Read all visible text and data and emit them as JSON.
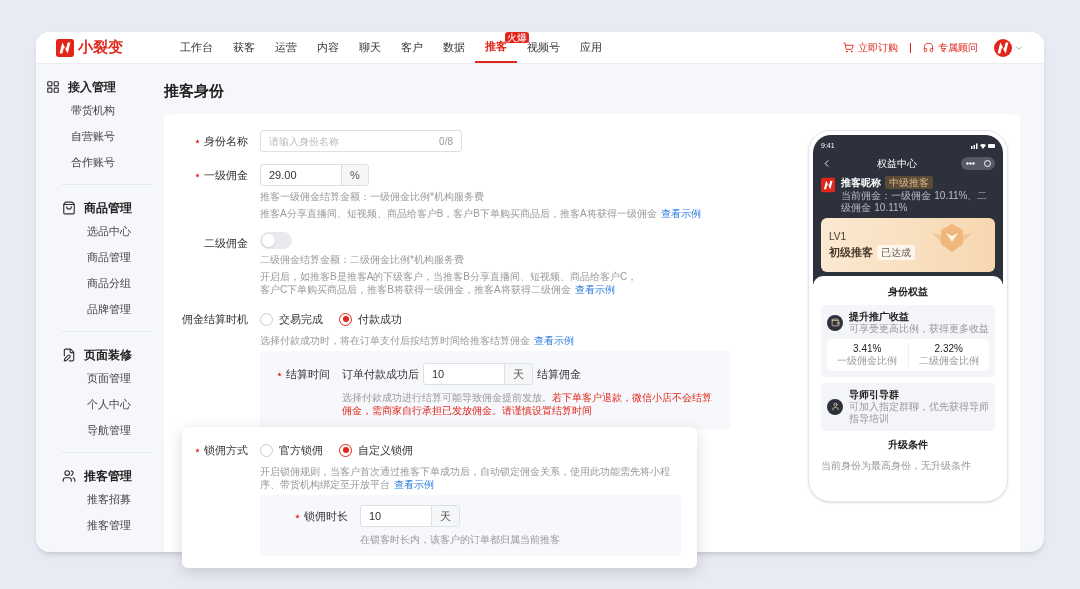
{
  "brand": {
    "name": "小裂变"
  },
  "nav": [
    {
      "label": "工作台",
      "selected": false
    },
    {
      "label": "获客",
      "selected": false
    },
    {
      "label": "运营",
      "selected": false
    },
    {
      "label": "内容",
      "selected": false
    },
    {
      "label": "聊天",
      "selected": false
    },
    {
      "label": "客户",
      "selected": false
    },
    {
      "label": "数据",
      "selected": false
    },
    {
      "label": "推客",
      "selected": true,
      "badge": "火爆"
    },
    {
      "label": "视频号",
      "selected": false
    },
    {
      "label": "应用",
      "selected": false
    }
  ],
  "header_actions": [
    {
      "label": "立即订购"
    },
    {
      "label": "专属顾问"
    }
  ],
  "sidebar": [
    {
      "title": "接入管理",
      "items": [
        "带货机构",
        "自营账号",
        "合作账号"
      ]
    },
    {
      "title": "商品管理",
      "items": [
        "选品中心",
        "商品管理",
        "商品分组",
        "品牌管理"
      ]
    },
    {
      "title": "页面装修",
      "items": [
        "页面管理",
        "个人中心",
        "导航管理"
      ]
    },
    {
      "title": "推客管理",
      "items": [
        "推客招募",
        "推客管理"
      ]
    }
  ],
  "page_title": "推客身份",
  "form": {
    "name_field": {
      "label": "身份名称",
      "required": true,
      "placeholder": "请输入身份名称",
      "counter": "0/8"
    },
    "level1": {
      "label": "一级佣金",
      "required": true,
      "value": "29.00",
      "unit": "%",
      "help": [
        "推客一级佣金结算金额：一级佣金比例*机构服务费",
        "推客A分享直播间、短视频、商品给客户B，客户B下单购买商品后，推客A将获得一级佣金"
      ],
      "link": "查看示例"
    },
    "level2": {
      "label": "二级佣金",
      "required": false,
      "on": false,
      "help": [
        "二级佣金结算金额：二级佣金比例*机构服务费",
        "开启后，如推客B是推客A的下级客户，当推客B分享直播间、短视频、商品给客户C，客户C下单购买商品后，推客B将获得一级佣金，推客A将获得二级佣金"
      ],
      "link": "查看示例"
    },
    "timing": {
      "label": "佣金结算时机",
      "required": false,
      "options": [
        {
          "label": "交易完成",
          "selected": false
        },
        {
          "label": "付款成功",
          "selected": true
        }
      ],
      "help": "选择付款成功时，将在订单支付后按结算时间给推客结算佣金",
      "link": "查看示例",
      "sub": {
        "label": "结算时间",
        "required": true,
        "prefix": "订单付款成功后",
        "value": "10",
        "unit": "天",
        "suffix": "结算佣金",
        "help": "选择付款成功进行结算可能导致佣金提前发放。",
        "warning": "若下单客户退款，微信小店不会结算佣金，需商家自行承担已发放佣金。请谨慎设置结算时间"
      }
    }
  },
  "lock_popup": {
    "label": "锁佣方式",
    "required": true,
    "options": [
      {
        "label": "官方锁佣",
        "selected": false
      },
      {
        "label": "自定义锁佣",
        "selected": true
      }
    ],
    "help": "开启锁佣规则，当客户首次通过推客下单成功后，自动锁定佣金关系，使用此功能需先将小程序、带货机构绑定至开放平台",
    "link": "查看示例",
    "sub": {
      "label": "锁佣时长",
      "required": true,
      "value": "10",
      "unit": "天",
      "help": "在锁客时长内，该客户的订单都归属当前推客"
    }
  },
  "phone": {
    "time": "9:41",
    "title": "权益中心",
    "nickname": "推客昵称",
    "tag": "中级推客",
    "commission": "当前佣金：一级佣金 10.11%、二级佣金 10.11%",
    "level": "LV1",
    "level_name": "初级推客",
    "level_status": "已达成",
    "benefits_title": "身份权益",
    "benefits": [
      {
        "title": "提升推广收益",
        "desc": "可享受更高比例，获得更多收益",
        "stats": [
          {
            "value": "3.41%",
            "label": "一级佣金比例"
          },
          {
            "value": "2.32%",
            "label": "二级佣金比例"
          }
        ]
      },
      {
        "title": "导师引导群",
        "desc": "可加入指定群聊，优先获得导师指导培训"
      }
    ],
    "upgrade_title": "升级条件",
    "upgrade_text": "当前身份为最高身份，无升级条件"
  }
}
